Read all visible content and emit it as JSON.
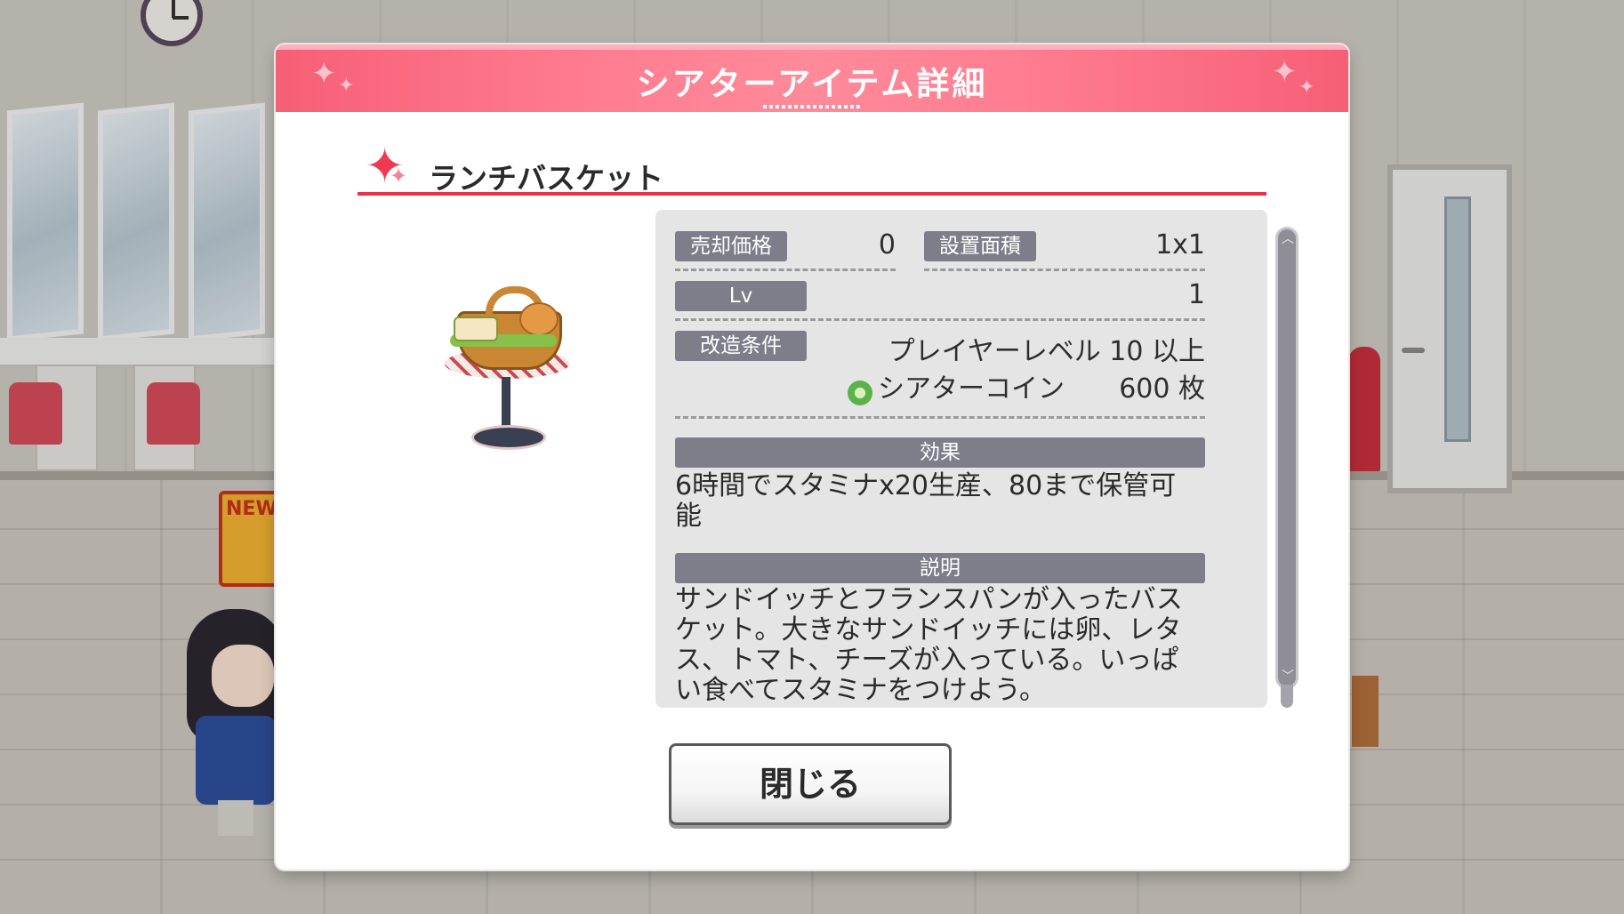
{
  "dialog": {
    "title": "シアターアイテム詳細",
    "item_name": "ランチバスケット",
    "close_label": "閉じる"
  },
  "details": {
    "sell_price_label": "売却価格",
    "sell_price_value": "0",
    "area_label": "設置面積",
    "area_value": "1x1",
    "level_label": "Lv",
    "level_value": "1",
    "upgrade_label": "改造条件",
    "upgrade_condition_1": "プレイヤーレベル 10 以上",
    "upgrade_condition_2_name": "シアターコイン",
    "upgrade_condition_2_amount": "600 枚",
    "effect_label": "効果",
    "effect_text": "6時間でスタミナx20生産、80まで保管可能",
    "description_label": "説明",
    "description_text": "サンドイッチとフランスパンが入ったバスケット。大きなサンドイッチには卵、レタス、トマト、チーズが入っている。いっぱい食べてスタミナをつけよう。"
  },
  "background": {
    "new_sign": "NEW"
  },
  "colors": {
    "header": "#f65f76",
    "accent": "#e8314a",
    "tag": "#7e7e8a",
    "panel": "#e5e5e5"
  },
  "icons": [
    "sparkle-icon",
    "coin-icon",
    "scroll-up-icon",
    "scroll-down-icon"
  ]
}
